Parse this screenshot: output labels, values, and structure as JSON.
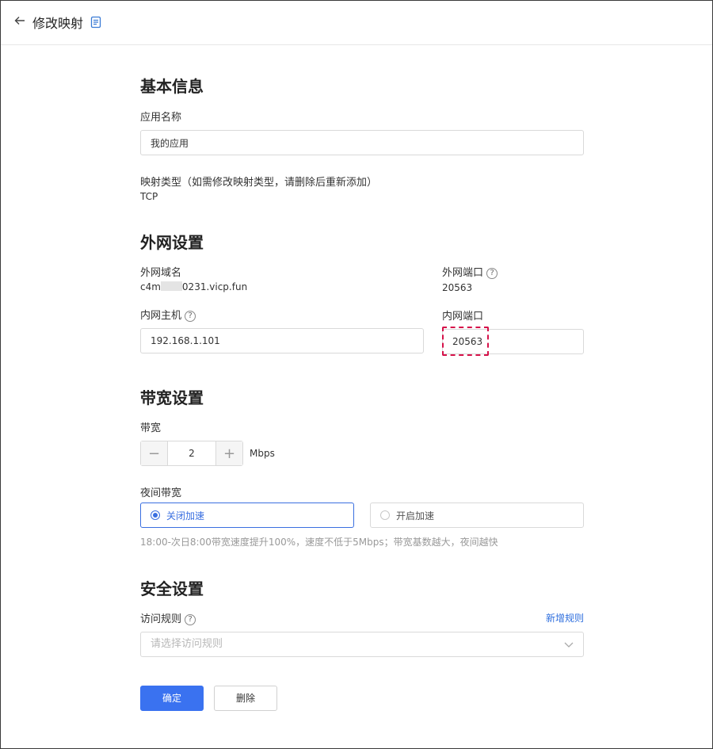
{
  "header": {
    "title": "修改映射"
  },
  "basic": {
    "title": "基本信息",
    "app_name_label": "应用名称",
    "app_name_value": "我的应用",
    "type_label": "映射类型（如需修改映射类型，请删除后重新添加）",
    "type_value": "TCP"
  },
  "network": {
    "title": "外网设置",
    "domain_label": "外网域名",
    "domain_prefix": "c4m",
    "domain_suffix": "0231.vicp.fun",
    "ext_port_label": "外网端口",
    "ext_port_value": "20563",
    "host_label": "内网主机",
    "host_value": "192.168.1.101",
    "int_port_label": "内网端口",
    "int_port_value": "20563"
  },
  "bandwidth": {
    "title": "带宽设置",
    "label": "带宽",
    "value": "2",
    "unit": "Mbps",
    "minus": "−",
    "plus": "+",
    "night_label": "夜间带宽",
    "option_off": "关闭加速",
    "option_on": "开启加速",
    "selected": "关闭加速",
    "hint": "18:00-次日8:00带宽速度提升100%，速度不低于5Mbps；带宽基数越大，夜间越快"
  },
  "security": {
    "title": "安全设置",
    "rules_label": "访问规则",
    "add_rule": "新增规则",
    "select_placeholder": "请选择访问规则"
  },
  "actions": {
    "confirm": "确定",
    "delete": "删除"
  },
  "help_glyph": "?",
  "colors": {
    "primary": "#3a72f0",
    "highlight": "#d6124a",
    "link": "#2f6fde"
  },
  "icons": {
    "back": "arrow-left-icon",
    "doc": "document-icon",
    "help": "question-circle-icon",
    "chevron": "chevron-down-icon"
  }
}
